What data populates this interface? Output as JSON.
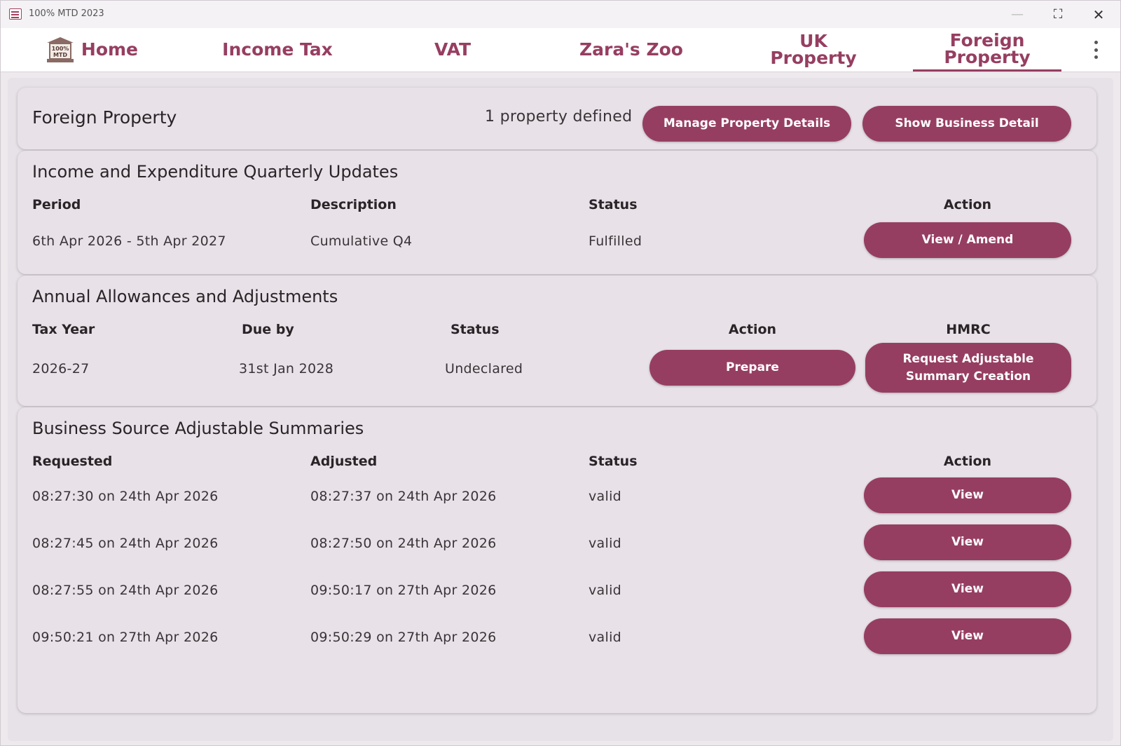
{
  "window": {
    "title": "100% MTD 2023",
    "controls": {
      "minimize": "—",
      "maximize": "⛶",
      "close": "✕"
    }
  },
  "nav": {
    "tabs": [
      {
        "label": "Home",
        "icon": "building-icon",
        "icon_text": "100% MTD"
      },
      {
        "label": "Income Tax"
      },
      {
        "label": "VAT"
      },
      {
        "label": "Zara's Zoo"
      },
      {
        "label": "UK Property"
      },
      {
        "label": "Foreign Property",
        "active": true
      }
    ],
    "menu_icon": "more-vert-icon"
  },
  "header_card": {
    "title": "Foreign Property",
    "summary": "1 property defined",
    "manage_button": "Manage Property Details",
    "show_button": "Show Business Detail"
  },
  "quarterly": {
    "title": "Income and Expenditure Quarterly Updates",
    "headers": {
      "period": "Period",
      "description": "Description",
      "status": "Status",
      "action": "Action"
    },
    "rows": [
      {
        "period": "6th Apr 2026 - 5th Apr 2027",
        "description": "Cumulative Q4",
        "status": "Fulfilled",
        "action": "View / Amend"
      }
    ]
  },
  "annual": {
    "title": "Annual Allowances and Adjustments",
    "headers": {
      "tax_year": "Tax Year",
      "due_by": "Due by",
      "status": "Status",
      "action": "Action",
      "hmrc": "HMRC"
    },
    "rows": [
      {
        "tax_year": "2026-27",
        "due_by": "31st Jan 2028",
        "status": "Undeclared",
        "action": "Prepare",
        "hmrc_line1": "Request Adjustable",
        "hmrc_line2": "Summary Creation"
      }
    ]
  },
  "summaries": {
    "title": "Business Source Adjustable Summaries",
    "headers": {
      "requested": "Requested",
      "adjusted": "Adjusted",
      "status": "Status",
      "action": "Action"
    },
    "rows": [
      {
        "requested": "08:27:30 on 24th Apr 2026",
        "adjusted": "08:27:37 on 24th Apr 2026",
        "status": "valid",
        "action": "View"
      },
      {
        "requested": "08:27:45 on 24th Apr 2026",
        "adjusted": "08:27:50 on 24th Apr 2026",
        "status": "valid",
        "action": "View"
      },
      {
        "requested": "08:27:55 on 24th Apr 2026",
        "adjusted": "09:50:17 on 27th Apr 2026",
        "status": "valid",
        "action": "View"
      },
      {
        "requested": "09:50:21 on 27th Apr 2026",
        "adjusted": "09:50:29 on 27th Apr 2026",
        "status": "valid",
        "action": "View"
      }
    ]
  },
  "colors": {
    "accent": "#963e61",
    "card_background": "#e8e2e8",
    "window_background": "#ede9ed"
  }
}
